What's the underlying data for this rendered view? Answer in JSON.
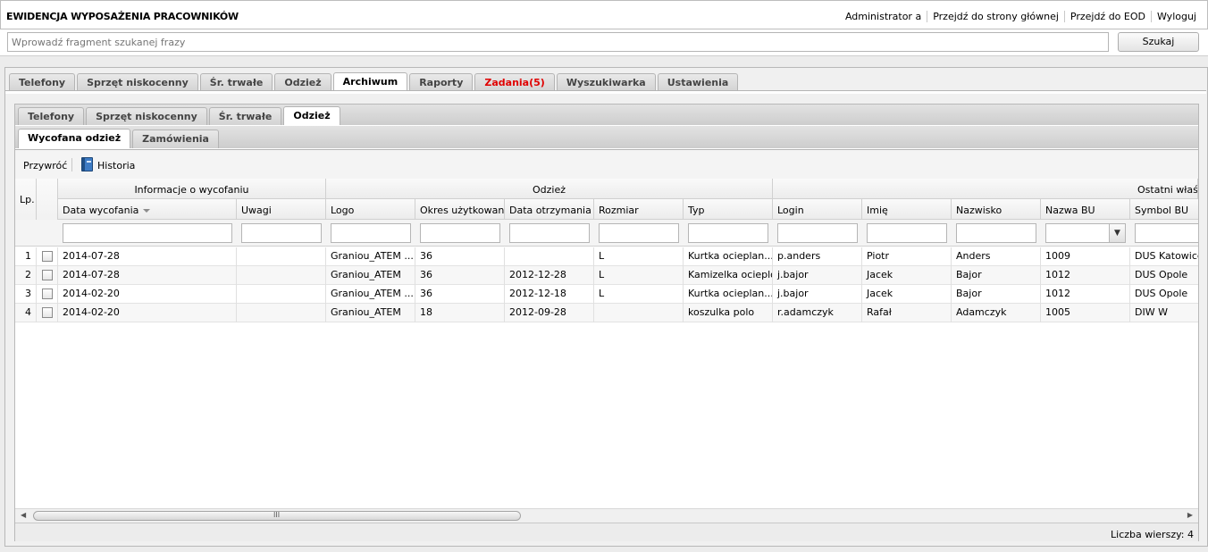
{
  "header": {
    "title": "EWIDENCJA WYPOSAŻENIA PRACOWNIKÓW",
    "links": [
      "Administrator a",
      "Przejdź do strony głównej",
      "Przejdź do EOD",
      "Wyloguj"
    ]
  },
  "search": {
    "placeholder": "Wprowadź fragment szukanej frazy",
    "button": "Szukaj"
  },
  "main_tabs": [
    {
      "label": "Telefony",
      "state": "normal"
    },
    {
      "label": "Sprzęt niskocenny",
      "state": "normal"
    },
    {
      "label": "Śr. trwałe",
      "state": "normal"
    },
    {
      "label": "Odzież",
      "state": "normal"
    },
    {
      "label": "Archiwum",
      "state": "active"
    },
    {
      "label": "Raporty",
      "state": "normal"
    },
    {
      "label": "Zadania(5)",
      "state": "alert"
    },
    {
      "label": "Wyszukiwarka",
      "state": "normal"
    },
    {
      "label": "Ustawienia",
      "state": "normal"
    }
  ],
  "sub_tabs": [
    {
      "label": "Telefony",
      "state": "normal"
    },
    {
      "label": "Sprzęt niskocenny",
      "state": "normal"
    },
    {
      "label": "Śr. trwałe",
      "state": "normal"
    },
    {
      "label": "Odzież",
      "state": "active"
    }
  ],
  "sub2_tabs": [
    {
      "label": "Wycofana odzież",
      "state": "active"
    },
    {
      "label": "Zamówienia",
      "state": "normal"
    }
  ],
  "toolbar": {
    "restore": "Przywróć",
    "history": "Historia",
    "history_icon": "book-icon"
  },
  "grid": {
    "lp_header": "Lp.",
    "groups": [
      {
        "label": "Informacje o wycofaniu"
      },
      {
        "label": "Odzież"
      },
      {
        "label": "Ostatni właściciel"
      }
    ],
    "columns": [
      "Data wycofania",
      "Uwagi",
      "Logo",
      "Okres użytkowania",
      "Data otrzymania",
      "Rozmiar",
      "Typ",
      "Login",
      "Imię",
      "Nazwisko",
      "Nazwa BU",
      "Symbol BU"
    ],
    "rows": [
      {
        "lp": "1",
        "cells": [
          "2014-07-28",
          "",
          "Graniou_ATEM ...",
          "36",
          "",
          "L",
          "Kurtka ocieplan...",
          "p.anders",
          "Piotr",
          "Anders",
          "1009",
          "DUS Katowice"
        ]
      },
      {
        "lp": "2",
        "cells": [
          "2014-07-28",
          "",
          "Graniou_ATEM",
          "36",
          "2012-12-28",
          "L",
          "Kamizelka ocieplo...",
          "j.bajor",
          "Jacek",
          "Bajor",
          "1012",
          "DUS Opole"
        ]
      },
      {
        "lp": "3",
        "cells": [
          "2014-02-20",
          "",
          "Graniou_ATEM ...",
          "36",
          "2012-12-18",
          "L",
          "Kurtka ocieplan...",
          "j.bajor",
          "Jacek",
          "Bajor",
          "1012",
          "DUS Opole"
        ]
      },
      {
        "lp": "4",
        "cells": [
          "2014-02-20",
          "",
          "Graniou_ATEM",
          "18",
          "2012-09-28",
          "",
          "koszulka polo",
          "r.adamczyk",
          "Rafał",
          "Adamczyk",
          "1005",
          "DIW W"
        ]
      }
    ]
  },
  "status": {
    "row_count": "Liczba wierszy: 4"
  }
}
